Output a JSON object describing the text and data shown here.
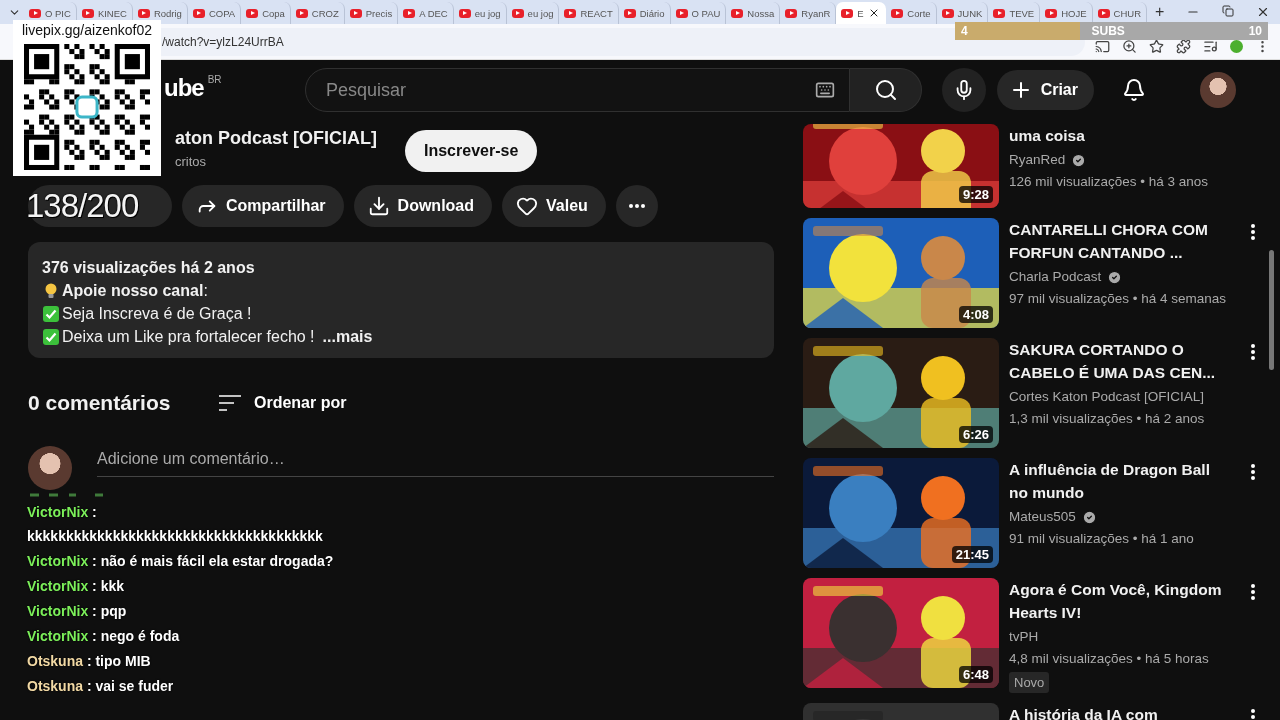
{
  "browser": {
    "tabs": [
      {
        "label": "O PIC",
        "selected": false
      },
      {
        "label": "KINEC",
        "selected": false
      },
      {
        "label": "Rodrig",
        "selected": false
      },
      {
        "label": "COPA",
        "selected": false
      },
      {
        "label": "Copa",
        "selected": false
      },
      {
        "label": "CROZ",
        "selected": false
      },
      {
        "label": "Precis",
        "selected": false
      },
      {
        "label": "A DEC",
        "selected": false
      },
      {
        "label": "eu jog",
        "selected": false
      },
      {
        "label": "eu jog",
        "selected": false
      },
      {
        "label": "REACT",
        "selected": false
      },
      {
        "label": "Diário",
        "selected": false
      },
      {
        "label": "O PAU",
        "selected": false
      },
      {
        "label": "Nossa",
        "selected": false
      },
      {
        "label": "RyanR",
        "selected": false
      },
      {
        "label": "E",
        "selected": true
      },
      {
        "label": "Corte",
        "selected": false
      },
      {
        "label": "JUNK",
        "selected": false
      },
      {
        "label": "TEVE",
        "selected": false
      },
      {
        "label": "HOJE",
        "selected": false
      },
      {
        "label": "CHUR",
        "selected": false
      }
    ],
    "new_tab": "+",
    "address": "/watch?v=ylzL24UrrBA"
  },
  "header": {
    "logo": "ube",
    "region": "BR",
    "search": {
      "placeholder": "Pesquisar"
    },
    "create": "Criar"
  },
  "channel": {
    "name": "aton Podcast [OFICIAL]",
    "subscribers": "critos",
    "subscribe": "Inscrever-se"
  },
  "actions": [
    {
      "label": "Compartilhar",
      "kind": "share"
    },
    {
      "label": "Download",
      "kind": "download"
    },
    {
      "label": "Valeu",
      "kind": "thanks"
    }
  ],
  "description": {
    "lines": [
      {
        "kind": "meta",
        "text": "376 visualizações  há 2 anos"
      },
      {
        "kind": "bulb",
        "text": "**Apoie nosso canal**:"
      },
      {
        "kind": "check",
        "text": "Seja Inscreva é de Graça !"
      },
      {
        "kind": "check",
        "text": "Deixa um Like pra fortalecer fecho !"
      }
    ],
    "more": "...mais"
  },
  "comments": {
    "count": "0 comentários",
    "sort": "Ordenar por",
    "placeholder": "Adicione um comentário…"
  },
  "recommendations": [
    {
      "title": "uma coisa",
      "channel": "RyanRed",
      "verified": true,
      "stats": "126 mil visualizações • há 3 anos",
      "duration": "9:28"
    },
    {
      "title": "CANTARELLI CHORA COM FORFUN CANTANDO ...",
      "channel": "Charla Podcast",
      "verified": true,
      "stats": "97 mil visualizações • há 4 semanas",
      "duration": "4:08"
    },
    {
      "title": "SAKURA CORTANDO O CABELO É UMA DAS CEN...",
      "channel": "Cortes Katon Podcast [OFICIAL]",
      "verified": false,
      "stats": "1,3 mil visualizações • há 2 anos",
      "duration": "6:26"
    },
    {
      "title": "A influência de Dragon Ball no mundo",
      "channel": "Mateus505",
      "verified": true,
      "stats": "91 mil visualizações • há 1 ano",
      "duration": "21:45"
    },
    {
      "title": "Agora é Com Você, Kingdom Hearts IV!",
      "channel": "tvPH",
      "verified": false,
      "stats": "4,8 mil visualizações • há 5 horas",
      "duration": "6:48",
      "badge": "Novo"
    },
    {
      "title": "A história da IA com"
    }
  ],
  "overlay": {
    "qr_caption": "livepix.gg/aizenkof02",
    "subs": {
      "current": "4",
      "label": "SUBS",
      "goal": "10",
      "level": 0.4
    },
    "like_counter": "138/200",
    "chat": [
      {
        "user": "VictorNix",
        "color": "#7cf05a",
        "message": ": kkkkkkkkkkkkkkkkkkkkkkkkkkkkkkkkkkkkkk"
      },
      {
        "user": "VictorNix",
        "color": "#7cf05a",
        "message": ": não é mais fácil ela estar drogada?"
      },
      {
        "user": "VictorNix",
        "color": "#7cf05a",
        "message": ": kkk"
      },
      {
        "user": "VictorNix",
        "color": "#7cf05a",
        "message": ": pqp"
      },
      {
        "user": "VictorNix",
        "color": "#7cf05a",
        "message": ": nego é foda"
      },
      {
        "user": "Otskuna",
        "color": "#f2d9a4",
        "message": ": tipo MIB"
      },
      {
        "user": "Otskuna",
        "color": "#f2d9a4",
        "message": ": vai se fuder"
      }
    ]
  }
}
